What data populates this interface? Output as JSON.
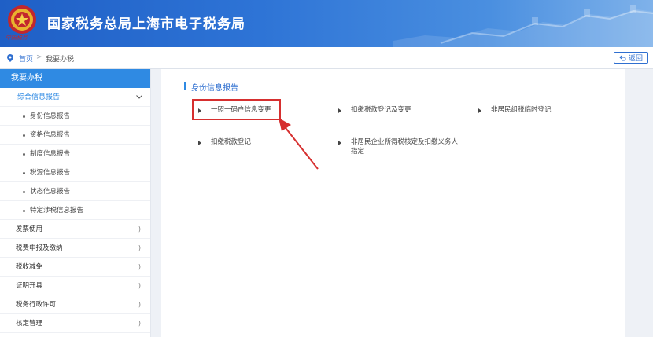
{
  "header": {
    "title": "国家税务总局上海市电子税务局",
    "emblem_text": "中国税务"
  },
  "breadcrumb": {
    "home": "首页",
    "separator": ">",
    "current": "我要办税",
    "back_label": "返回"
  },
  "sidebar": {
    "heading": "我要办税",
    "expanded_group": "综合信息报告",
    "sub_items": [
      "身份信息报告",
      "资格信息报告",
      "制度信息报告",
      "税源信息报告",
      "状态信息报告",
      "特定涉税信息报告"
    ],
    "top_items": [
      "发票使用",
      "税费申报及缴纳",
      "税收减免",
      "证明开具",
      "税务行政许可",
      "核定管理"
    ]
  },
  "main": {
    "section_title": "身份信息报告",
    "links": [
      "一照一码户信息变更",
      "扣缴税款登记及变更",
      "非居民组税临时登记",
      "扣缴税款登记",
      "非居民企业所得税核定及扣缴义务人指定"
    ],
    "highlight_color": "#d62f2f"
  },
  "colors": {
    "header_blue": "#1f5fc6",
    "accent_blue": "#2f8ae3",
    "link_blue": "#2f6fd0"
  }
}
